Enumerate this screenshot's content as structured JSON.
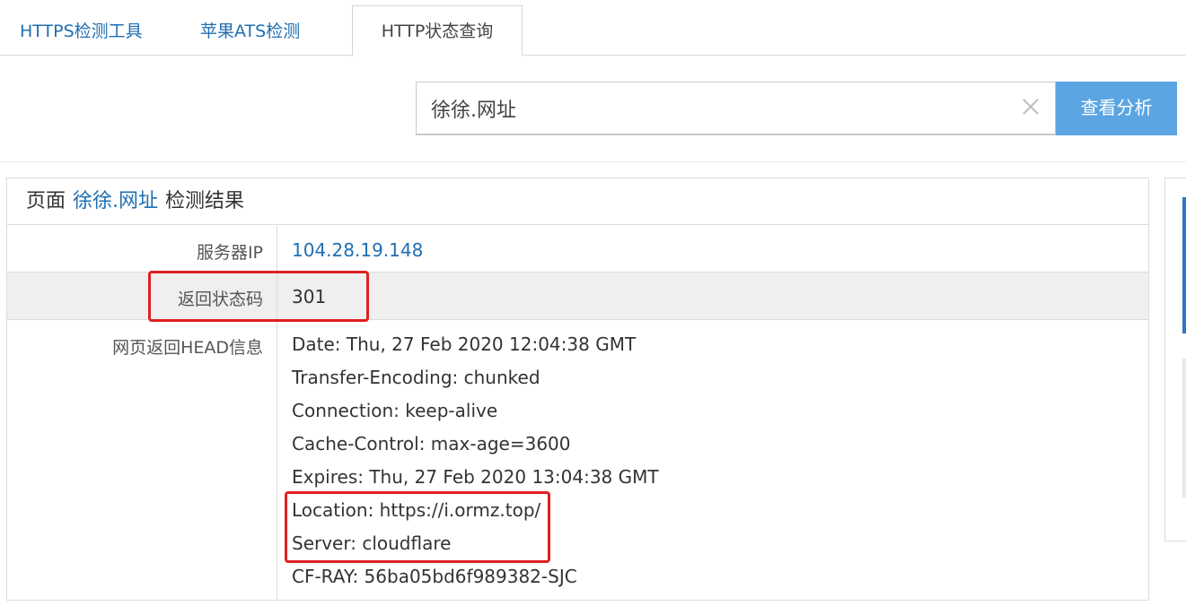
{
  "tabs": [
    {
      "label": "HTTPS检测工具"
    },
    {
      "label": "苹果ATS检测"
    },
    {
      "label": "HTTP状态查询",
      "active": true
    }
  ],
  "search": {
    "value": "徐徐.网址",
    "button_label": "查看分析"
  },
  "result": {
    "header_prefix": "页面",
    "header_domain": "徐徐.网址",
    "header_suffix": "检测结果",
    "rows": {
      "ip": {
        "label": "服务器IP",
        "value": "104.28.19.148"
      },
      "status": {
        "label": "返回状态码",
        "value": "301"
      },
      "head": {
        "label": "网页返回HEAD信息",
        "lines": [
          "Date: Thu, 27 Feb 2020 12:04:38 GMT",
          "Transfer-Encoding: chunked",
          "Connection: keep-alive",
          "Cache-Control: max-age=3600",
          "Expires: Thu, 27 Feb 2020 13:04:38 GMT",
          "Location: https://i.ormz.top/",
          "Server: cloudflare",
          "CF-RAY: 56ba05bd6f989382-SJC"
        ]
      }
    }
  },
  "colors": {
    "accent": "#5aa5e2",
    "link": "#1f6fb2",
    "highlight": "#e02020"
  },
  "icons": {
    "clear": "close-icon"
  }
}
